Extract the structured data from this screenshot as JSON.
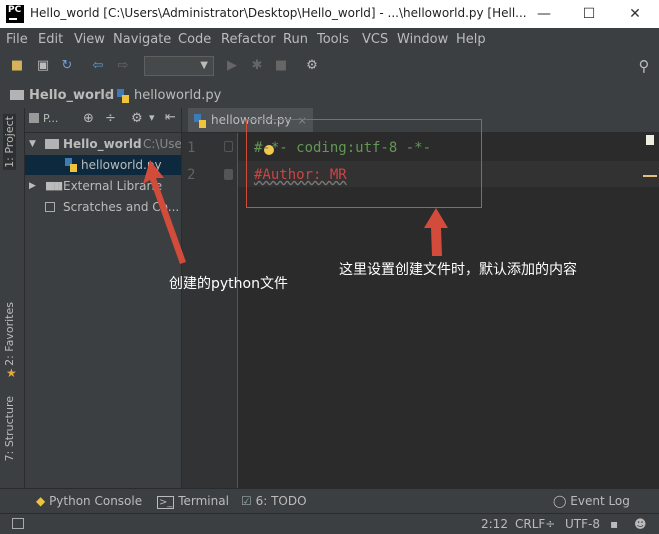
{
  "window": {
    "title": "Hello_world [C:\\Users\\Administrator\\Desktop\\Hello_world] - ...\\helloworld.py [Hell...",
    "logo_text": "PC"
  },
  "menu": [
    "File",
    "Edit",
    "View",
    "Navigate",
    "Code",
    "Refactor",
    "Run",
    "Tools",
    "VCS",
    "Window",
    "Help"
  ],
  "breadcrumb": {
    "project": "Hello_world",
    "file": "helloworld.py"
  },
  "sidebar": {
    "project_tab": "1: Project",
    "favorites_tab": "2: Favorites",
    "structure_tab": "7: Structure",
    "view_selector": "P..."
  },
  "tree": {
    "root_name": "Hello_world",
    "root_path": "C:\\Use",
    "file": "helloworld.py",
    "external": "External Librarie",
    "scratches": "Scratches and Co..."
  },
  "editor": {
    "tab_label": "helloworld.py",
    "tab_close": "×",
    "line_numbers": [
      "1",
      "2"
    ],
    "lines": [
      "#-*- coding:utf-8 -*-",
      "#Author: MR"
    ]
  },
  "annotations": {
    "file_created": "创建的python文件",
    "default_content": "这里设置创建文件时，默认添加的内容"
  },
  "bottom_tools": {
    "python_console": "Python Console",
    "terminal": "Terminal",
    "todo": "6: TODO",
    "event_log": "Event Log"
  },
  "status": {
    "position": "2:12",
    "line_sep": "CRLF÷",
    "encoding": "UTF-8"
  },
  "colors": {
    "annotation_red": "#d34b3b",
    "comment_green": "#629755",
    "author_red": "#cc4444"
  }
}
